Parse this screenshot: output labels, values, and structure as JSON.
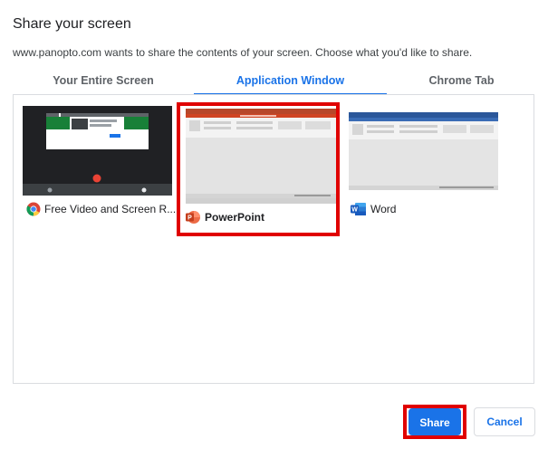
{
  "dialog": {
    "title": "Share your screen",
    "subtitle": "www.panopto.com wants to share the contents of your screen. Choose what you'd like to share."
  },
  "tabs": [
    {
      "label": "Your Entire Screen"
    },
    {
      "label": "Application Window"
    },
    {
      "label": "Chrome Tab"
    }
  ],
  "selected_tab": "Application Window",
  "windows": [
    {
      "label": "Free Video and Screen R...",
      "icon": "chrome-icon"
    },
    {
      "label": "PowerPoint",
      "icon": "powerpoint-icon"
    },
    {
      "label": "Word",
      "icon": "word-icon"
    }
  ],
  "selected_window": "PowerPoint",
  "footer": {
    "share_label": "Share",
    "cancel_label": "Cancel"
  },
  "colors": {
    "accent": "#1a73e8",
    "highlight": "#e00000",
    "powerpoint": "#d04423",
    "word": "#2b579a"
  }
}
